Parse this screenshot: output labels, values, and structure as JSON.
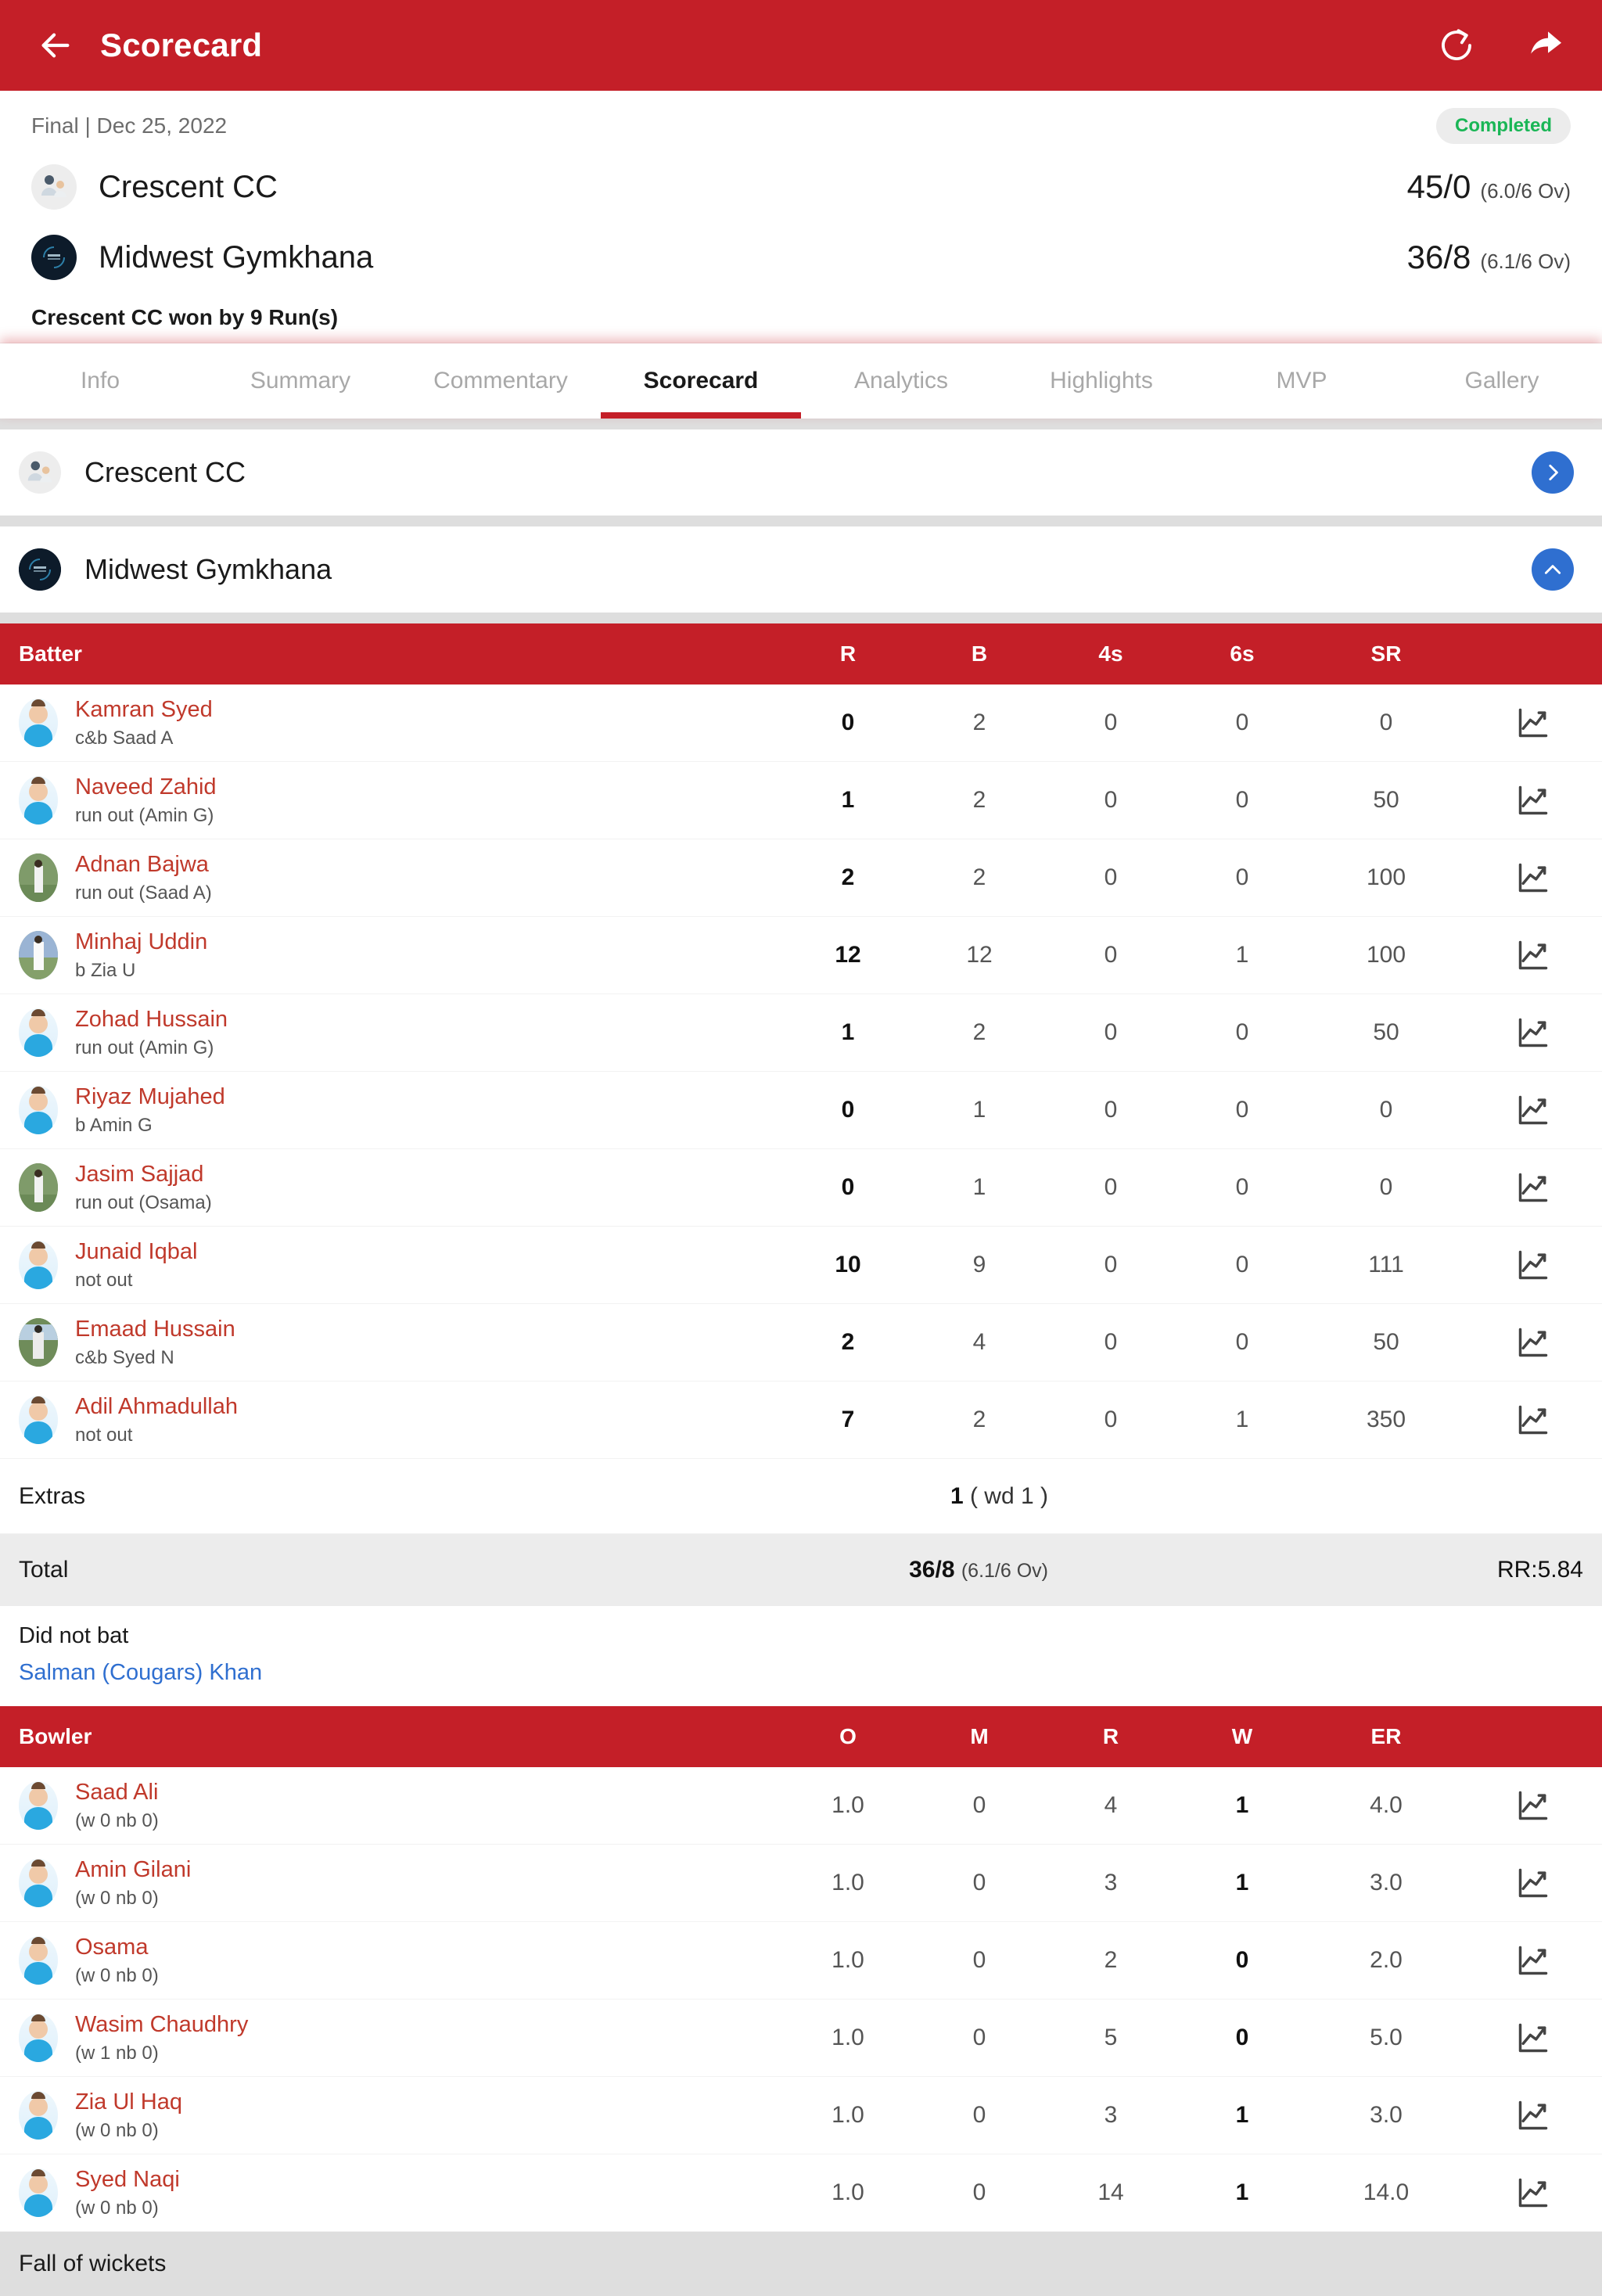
{
  "appbar": {
    "title": "Scorecard",
    "back_icon": "arrow-left-icon",
    "refresh_icon": "refresh-icon",
    "share_icon": "share-icon"
  },
  "summary": {
    "meta": "Final | Dec 25, 2022",
    "status": "Completed",
    "teams": [
      {
        "name": "Crescent CC",
        "score": "45/0",
        "overs": "(6.0/6 Ov)"
      },
      {
        "name": "Midwest Gymkhana",
        "score": "36/8",
        "overs": "(6.1/6 Ov)"
      }
    ],
    "result": "Crescent CC won by 9 Run(s)"
  },
  "tabs": [
    {
      "label": "Info",
      "active": false
    },
    {
      "label": "Summary",
      "active": false
    },
    {
      "label": "Commentary",
      "active": false
    },
    {
      "label": "Scorecard",
      "active": true
    },
    {
      "label": "Analytics",
      "active": false
    },
    {
      "label": "Highlights",
      "active": false
    },
    {
      "label": "MVP",
      "active": false
    },
    {
      "label": "Gallery",
      "active": false
    }
  ],
  "innings": [
    {
      "team": "Crescent CC",
      "expanded": false
    },
    {
      "team": "Midwest Gymkhana",
      "expanded": true
    }
  ],
  "batting": {
    "headers": {
      "name": "Batter",
      "r": "R",
      "b": "B",
      "fours": "4s",
      "sixes": "6s",
      "sr": "SR"
    },
    "rows": [
      {
        "name": "Kamran Syed",
        "dismissal": "c&b Saad A",
        "r": "0",
        "b": "2",
        "fours": "0",
        "sixes": "0",
        "sr": "0"
      },
      {
        "name": "Naveed Zahid",
        "dismissal": "run out (Amin G)",
        "r": "1",
        "b": "2",
        "fours": "0",
        "sixes": "0",
        "sr": "50"
      },
      {
        "name": "Adnan Bajwa",
        "dismissal": "run out (Saad A)",
        "r": "2",
        "b": "2",
        "fours": "0",
        "sixes": "0",
        "sr": "100"
      },
      {
        "name": "Minhaj Uddin",
        "dismissal": "b Zia U",
        "r": "12",
        "b": "12",
        "fours": "0",
        "sixes": "1",
        "sr": "100"
      },
      {
        "name": "Zohad Hussain",
        "dismissal": "run out (Amin G)",
        "r": "1",
        "b": "2",
        "fours": "0",
        "sixes": "0",
        "sr": "50"
      },
      {
        "name": "Riyaz Mujahed",
        "dismissal": "b Amin G",
        "r": "0",
        "b": "1",
        "fours": "0",
        "sixes": "0",
        "sr": "0"
      },
      {
        "name": "Jasim Sajjad",
        "dismissal": "run out (Osama)",
        "r": "0",
        "b": "1",
        "fours": "0",
        "sixes": "0",
        "sr": "0"
      },
      {
        "name": "Junaid Iqbal",
        "dismissal": "not out",
        "r": "10",
        "b": "9",
        "fours": "0",
        "sixes": "0",
        "sr": "111"
      },
      {
        "name": "Emaad Hussain",
        "dismissal": "c&b Syed N",
        "r": "2",
        "b": "4",
        "fours": "0",
        "sixes": "0",
        "sr": "50"
      },
      {
        "name": "Adil Ahmadullah",
        "dismissal": "not out",
        "r": "7",
        "b": "2",
        "fours": "0",
        "sixes": "1",
        "sr": "350"
      }
    ],
    "extras": {
      "label": "Extras",
      "value": "1",
      "detail": "( wd 1 )"
    },
    "total": {
      "label": "Total",
      "value": "36/8",
      "overs": "(6.1/6 Ov)",
      "rr": "RR:5.84"
    },
    "did_not_bat": {
      "label": "Did not bat",
      "players": "Salman (Cougars) Khan"
    }
  },
  "bowling": {
    "headers": {
      "name": "Bowler",
      "o": "O",
      "m": "M",
      "r": "R",
      "w": "W",
      "er": "ER"
    },
    "rows": [
      {
        "name": "Saad Ali",
        "extras": "(w 0 nb 0)",
        "o": "1.0",
        "m": "0",
        "r": "4",
        "w": "1",
        "er": "4.0"
      },
      {
        "name": "Amin Gilani",
        "extras": "(w 0 nb 0)",
        "o": "1.0",
        "m": "0",
        "r": "3",
        "w": "1",
        "er": "3.0"
      },
      {
        "name": "Osama",
        "extras": "(w 0 nb 0)",
        "o": "1.0",
        "m": "0",
        "r": "2",
        "w": "0",
        "er": "2.0"
      },
      {
        "name": "Wasim Chaudhry",
        "extras": "(w 1 nb 0)",
        "o": "1.0",
        "m": "0",
        "r": "5",
        "w": "0",
        "er": "5.0"
      },
      {
        "name": "Zia Ul Haq",
        "extras": "(w 0 nb 0)",
        "o": "1.0",
        "m": "0",
        "r": "3",
        "w": "1",
        "er": "3.0"
      },
      {
        "name": "Syed Naqi",
        "extras": "(w 0 nb 0)",
        "o": "1.0",
        "m": "0",
        "r": "14",
        "w": "1",
        "er": "14.0"
      }
    ]
  },
  "fall_of_wickets": {
    "label": "Fall of wickets"
  },
  "colors": {
    "brand_red": "#c41f28",
    "player_link": "#c0392b",
    "blue_link": "#2f6fd0",
    "status_green": "#1ab656"
  }
}
